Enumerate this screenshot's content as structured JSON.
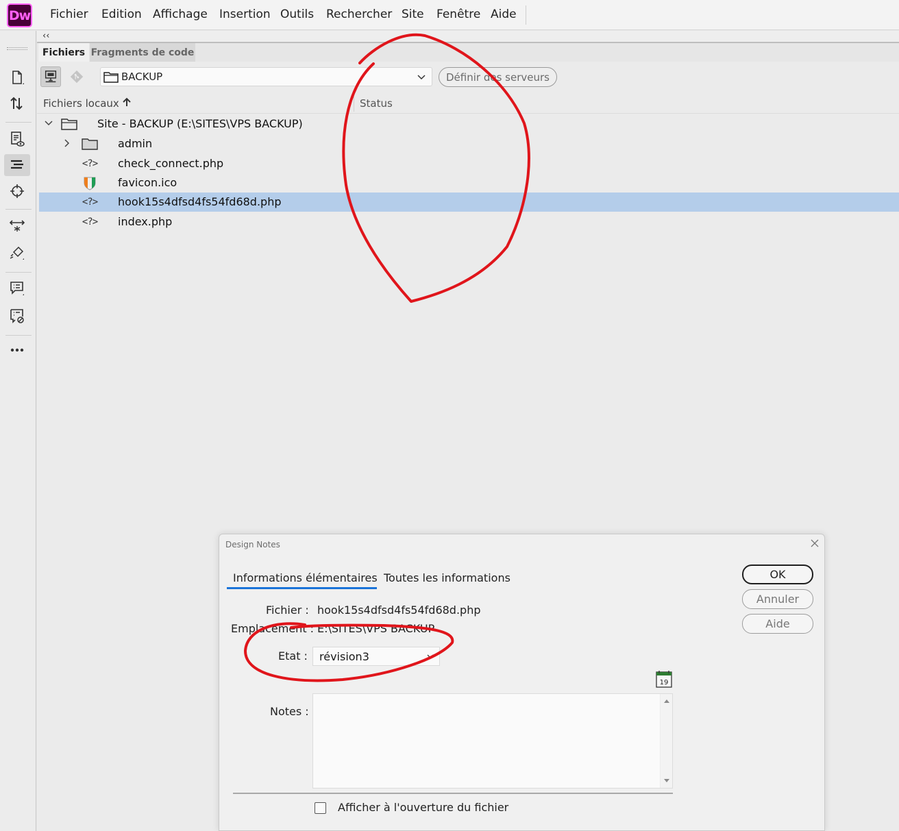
{
  "app": {
    "logo_text": "Dw",
    "accent_color": "#ff61f6",
    "logo_bg": "#470137"
  },
  "menu": {
    "items": [
      "Fichier",
      "Edition",
      "Affichage",
      "Insertion",
      "Outils",
      "Rechercher",
      "Site",
      "Fenêtre",
      "Aide"
    ]
  },
  "toolbar": {
    "tools": [
      "new-document-icon",
      "transfer-arrows-icon",
      "live-view-icon",
      "files-panel-icon",
      "target-icon",
      "expand-icon",
      "brush-icon",
      "comment-icon",
      "comment-disabled-icon",
      "more-icon"
    ]
  },
  "panel": {
    "collapse_label": "‹‹",
    "tabs": [
      "Fichiers",
      "Fragments de code"
    ],
    "site_name": "BACKUP",
    "define_servers_label": "Définir des serveurs",
    "col_local": "Fichiers locaux",
    "col_status": "Status",
    "tree": [
      {
        "name": "Site - BACKUP (E:\\SITES\\VPS BACKUP)",
        "type": "site"
      },
      {
        "name": "admin",
        "type": "folder"
      },
      {
        "name": "check_connect.php",
        "type": "code"
      },
      {
        "name": "favicon.ico",
        "type": "image"
      },
      {
        "name": "hook15s4dfsd4fs54fd68d.php",
        "type": "code",
        "selected": true
      },
      {
        "name": "index.php",
        "type": "code"
      }
    ],
    "selection_color": "#b4cdea"
  },
  "dialog": {
    "title": "Design Notes",
    "tabs": [
      "Informations élémentaires",
      "Toutes les informations"
    ],
    "ok_label": "OK",
    "cancel_label": "Annuler",
    "help_label": "Aide",
    "file_label": "Fichier :",
    "file_value": "hook15s4dfsd4fs54fd68d.php",
    "location_label": "Emplacement :",
    "location_value": "E:\\SITES\\VPS BACKUP",
    "state_label": "Etat :",
    "state_value": "révision3",
    "notes_label": "Notes :",
    "notes_value": "",
    "date_icon_text": "19",
    "show_on_open_label": "Afficher à l'ouverture du fichier",
    "tab_underline_color": "#1a73d9"
  },
  "annotation": {
    "color": "#e0151b"
  }
}
